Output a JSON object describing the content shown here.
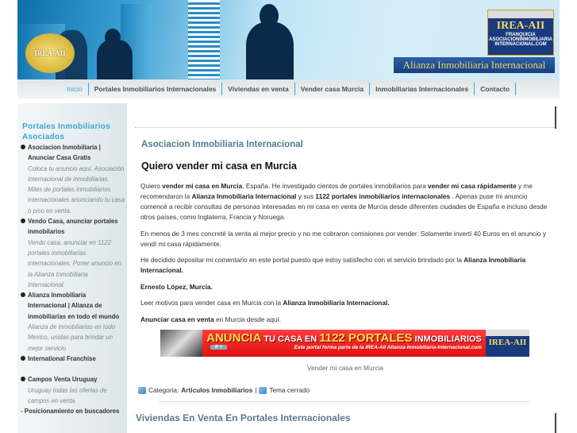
{
  "header": {
    "badge_text": "IREA-AII",
    "logo_title": "IREA-AII",
    "logo_sub": "FRANQUICIA",
    "logo_domain": "ASOCIACIONINMOBILIARIA INTERNACIONAL.COM",
    "brand": "Alianza Inmobiliaria Internacional"
  },
  "nav": [
    "Inicio",
    "Portales Inmobiliarios Internacionales",
    "Viviendas en venta",
    "Vender casa Murcia",
    "Inmobiliarias Internacionales",
    "Contacto"
  ],
  "sidebar": {
    "title": "Portales Inmobiliarios Asociados",
    "items": [
      {
        "label": "Asociacion Inmobiliaria | Anunciar Casa Gratis",
        "desc": "Coloca tu anuncio aquí. Asociación internacional de inmobiliarias. Miles de portales inmobiliarios internacionales anunciando tu casa o piso en venta."
      },
      {
        "label": "Vendo Casa, anunciar portales inmobilarios",
        "desc": "Vendo casa, anunciar en 1122 portales inmobiliarias internacionales. Poner anuncio en la Alianza Inmobiliaria Internacional."
      },
      {
        "label": "Alianza Inmobiliaria Internacional | Alianza de inmobiliarias en todo el mundo",
        "desc": "Alianza de inmobiliarias en todo Mexico, unidas para brindar un mejor servicio"
      },
      {
        "label": "International Franchise",
        "desc": ""
      },
      {
        "label": "Campos Venta Uruguay",
        "desc": "Uruguay todas las ofertas de campos en venta"
      }
    ],
    "last": "- Posicionamiento en buscadores"
  },
  "main": {
    "section_title": "Asociacion Inmobiliaria Internacional",
    "post_title": "Quiero vender mi casa en Murcia",
    "p1": {
      "a": "Quiero ",
      "b": "vender mi casa en Murcia",
      "c": ", España. He investigado cientos de portales inmobiliarios para ",
      "d": "vender mi casa rápidamente",
      "e": " y me recomendaron la ",
      "f": "Alianza Inmobiliaria Internacional",
      "g": " y sus ",
      "h": "1122 portales inmobiliarios internacionales",
      "i": " . Apenas puse mi anuncio comencé a recibir consultas de personas interesadas en mi casa en venta de Murcia desde diferentes ciudades de España e incluso desde otros países, como Inglaterra, Francia y Noruega."
    },
    "p2": "En menos de 3 mes concreté la venta al mejor precio y no me cobraron comisiones por vender. Solamente invertí 40 Euros en el anuncio y vendí mi casa rápidamente.",
    "p3": {
      "a": "He decidido depositar mi comentario en este portal puesto que estoy satisfecho con el servicio brindado por la ",
      "b": "Alianza Inmobiliaria Internacional."
    },
    "p4": "Ernesto López, Murcia.",
    "p5": {
      "a": "Leer motivos para vender casa en Murcia con la ",
      "b": "Alianza Inmobiliaria Internacional."
    },
    "p6": {
      "a": "Anunciar casa en venta",
      "b": " en Murcia desde aquí."
    },
    "banner": {
      "big1": "ANUNCIA",
      "big2": " TU CASA EN ",
      "big3": "1122 PORTALES",
      "big4": " INMOBILIARIOS",
      "button": "Ir >",
      "tagline": "Este portal forma parte de la IREA-AII Alianza-Inmobiliaria-Internacional.com",
      "logo": "IREA-AII"
    },
    "caption": "Vender mi casa en Murcia",
    "category_label": "Categoria: ",
    "category": "Articulos Inmobiliarios",
    "separator": " |",
    "closed": "Tema cerrado",
    "next_title": "Viviendas En Venta En Portales Internacionales"
  }
}
